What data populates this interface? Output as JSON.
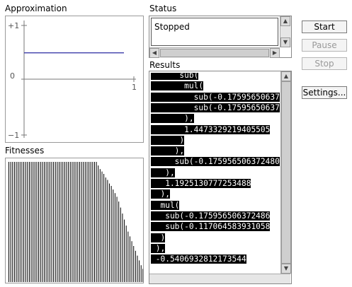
{
  "panels": {
    "approximation_title": "Approximation",
    "fitnesses_title": "Fitnesses",
    "status_title": "Status",
    "results_title": "Results"
  },
  "approx_axes": {
    "y_top": "+1",
    "y_mid": "0",
    "y_bottom": "−1",
    "x_end": "1",
    "line_value": 0.5
  },
  "fitness_bars": [
    1,
    1,
    1,
    1,
    1,
    1,
    1,
    1,
    1,
    1,
    1,
    1,
    1,
    1,
    1,
    1,
    1,
    1,
    1,
    1,
    1,
    1,
    1,
    1,
    1,
    1,
    1,
    1,
    1,
    1,
    1,
    1,
    1,
    1,
    1,
    1,
    1,
    1,
    1,
    1,
    1,
    1,
    1,
    1,
    1,
    1,
    1,
    1,
    0.97,
    0.94,
    0.92,
    0.9,
    0.87,
    0.85,
    0.82,
    0.8,
    0.77,
    0.74,
    0.71,
    0.67,
    0.62,
    0.57,
    0.52,
    0.47,
    0.42,
    0.38,
    0.34,
    0.3,
    0.26,
    0.22,
    0.18,
    0.14,
    0.11
  ],
  "status": {
    "text": "Stopped"
  },
  "results": {
    "lines": [
      {
        "indent": "      ",
        "text": "sub("
      },
      {
        "indent": "       ",
        "text": "mul("
      },
      {
        "indent": "         ",
        "text": "sub(-0.17595650637"
      },
      {
        "indent": "         ",
        "text": "sub(-0.17595650637"
      },
      {
        "indent": "       ",
        "text": "),"
      },
      {
        "indent": "       ",
        "text": "1.4473329219405505"
      },
      {
        "indent": "      ",
        "text": ")"
      },
      {
        "indent": "     ",
        "text": "),"
      },
      {
        "indent": "     ",
        "text": "sub(-0.175956506372480"
      },
      {
        "indent": "   ",
        "text": "),"
      },
      {
        "indent": "   ",
        "text": "1.1925130777253488"
      },
      {
        "indent": "  ",
        "text": "),"
      },
      {
        "indent": "  ",
        "text": "mul("
      },
      {
        "indent": "   ",
        "text": "sub(-0.175956506372486"
      },
      {
        "indent": "   ",
        "text": "sub(-0.117064583931058"
      },
      {
        "indent": "  ",
        "text": ")"
      },
      {
        "indent": " ",
        "text": "),"
      },
      {
        "indent": " ",
        "text": "-0.5406932812173544"
      }
    ]
  },
  "buttons": {
    "start": "Start",
    "pause": "Pause",
    "stop": "Stop",
    "settings": "Settings..."
  },
  "colors": {
    "line": "#2a2aa0",
    "bars": "#000000",
    "highlight": "#000000"
  }
}
